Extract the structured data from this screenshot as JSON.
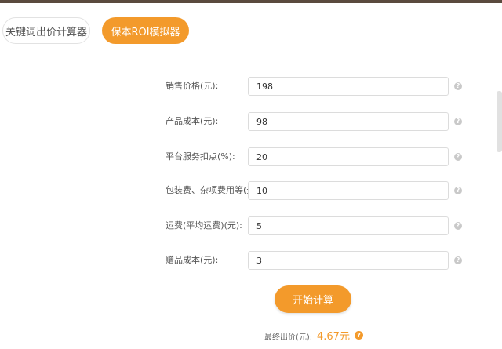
{
  "tabs": [
    {
      "label": "关键词出价计算器",
      "active": false
    },
    {
      "label": "保本ROI模拟器",
      "active": true
    }
  ],
  "form": {
    "fields": [
      {
        "label": "销售价格(元):",
        "value": "198"
      },
      {
        "label": "产品成本(元):",
        "value": "98"
      },
      {
        "label": "平台服务扣点(%):",
        "value": "20"
      },
      {
        "label": "包装费、杂项费用等(元):",
        "value": "10"
      },
      {
        "label": "运费(平均运费)(元):",
        "value": "5"
      },
      {
        "label": "赠品成本(元):",
        "value": "3"
      }
    ],
    "help_glyph": "?"
  },
  "calculate_button": "开始计算",
  "result": {
    "label": "最终出价(元):",
    "value": "4.67元",
    "help_glyph": "?"
  },
  "colors": {
    "accent": "#f39a2b",
    "help_icon": "#c9c9c9"
  }
}
